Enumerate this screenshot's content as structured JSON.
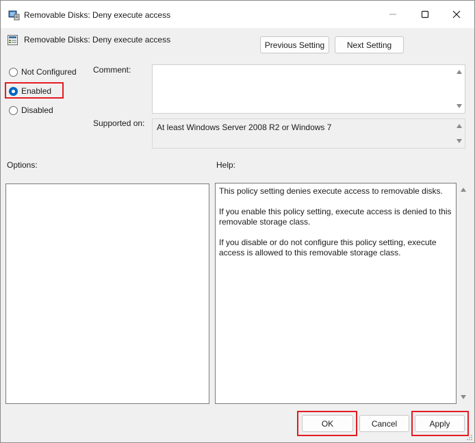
{
  "window": {
    "title": "Removable Disks: Deny execute access",
    "controls": {
      "minimize_icon": "minimize-icon",
      "maximize_icon": "maximize-icon",
      "close_icon": "close-icon"
    }
  },
  "header": {
    "title": "Removable Disks: Deny execute access",
    "previous_label": "Previous Setting",
    "next_label": "Next Setting"
  },
  "state": {
    "options": [
      {
        "label": "Not Configured",
        "checked": false
      },
      {
        "label": "Enabled",
        "checked": true
      },
      {
        "label": "Disabled",
        "checked": false
      }
    ]
  },
  "comment": {
    "label": "Comment:",
    "value": ""
  },
  "supported": {
    "label": "Supported on:",
    "value": "At least Windows Server 2008 R2 or Windows 7"
  },
  "options_pane": {
    "label": "Options:"
  },
  "help_pane": {
    "label": "Help:",
    "paragraphs": [
      "This policy setting denies execute access to removable disks.",
      "If you enable this policy setting, execute access is denied to this removable storage class.",
      "If you disable or do not configure this policy setting, execute access is allowed to this removable storage class."
    ]
  },
  "footer": {
    "ok_label": "OK",
    "cancel_label": "Cancel",
    "apply_label": "Apply"
  },
  "colors": {
    "accent": "#0067c0",
    "highlight": "#e31b23"
  }
}
